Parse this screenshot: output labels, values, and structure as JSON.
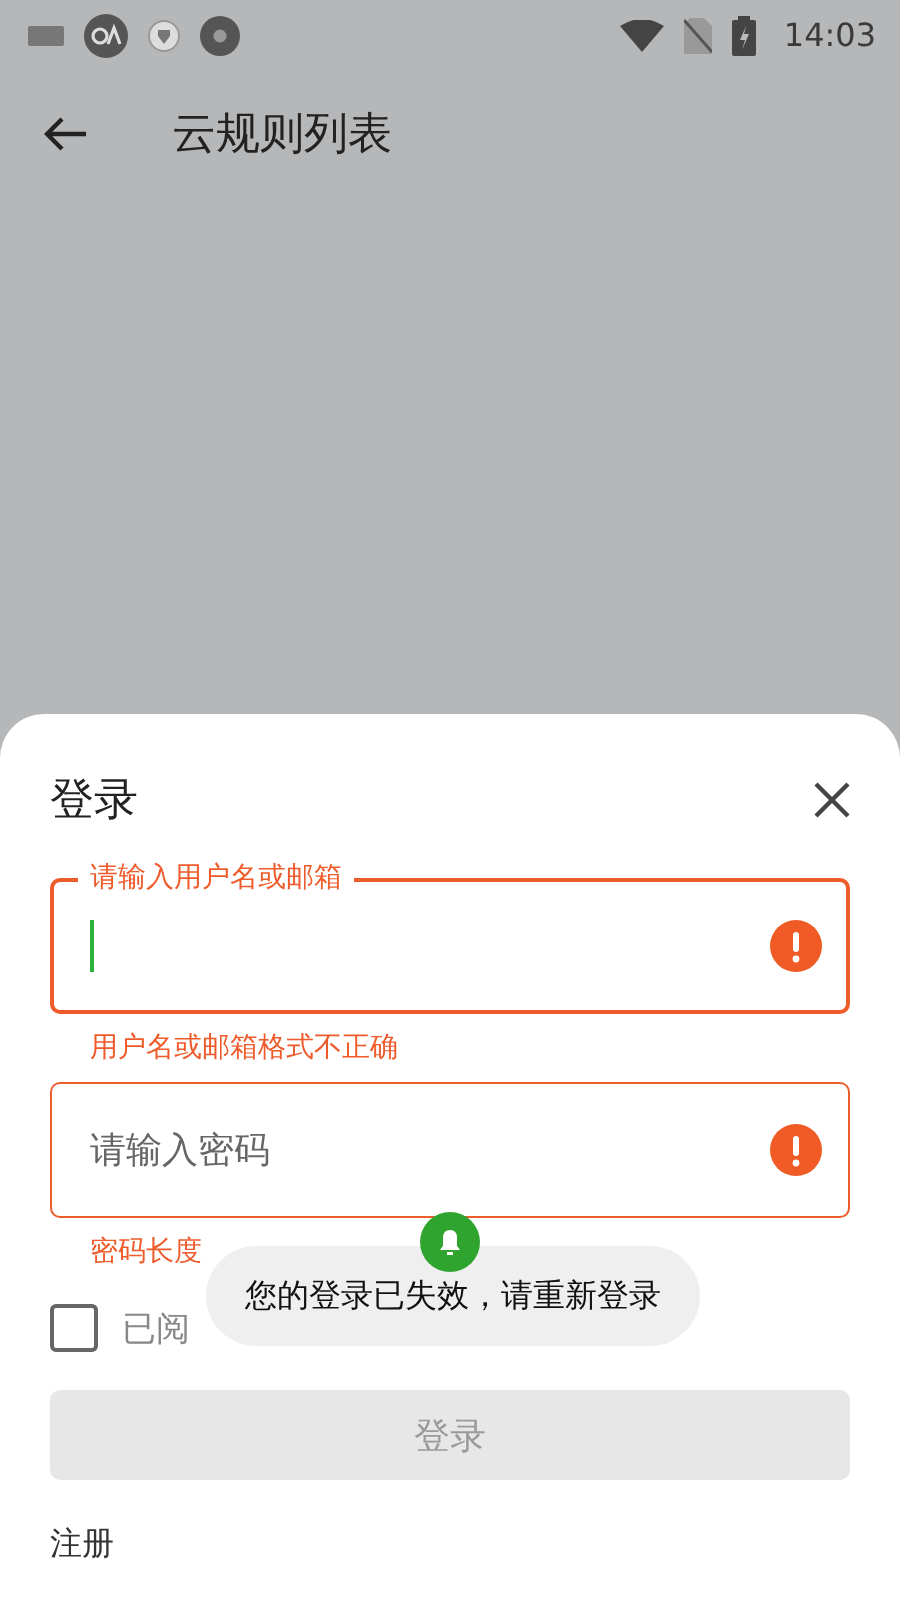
{
  "status_bar": {
    "time": "14:03"
  },
  "app_bar": {
    "title": "云规则列表"
  },
  "sheet": {
    "title": "登录",
    "fields": [
      {
        "label": "请输入用户名或邮箱",
        "focused": true,
        "error": "用户名或邮箱格式不正确"
      },
      {
        "placeholder": "请输入密码",
        "focused": false,
        "error": "密码长度"
      }
    ],
    "agreement": {
      "checked": false,
      "text": "已阅"
    },
    "submit": {
      "label": "登录",
      "disabled": true
    },
    "register": "注册"
  },
  "toast": {
    "message": "您的登录已失效，请重新登录"
  }
}
